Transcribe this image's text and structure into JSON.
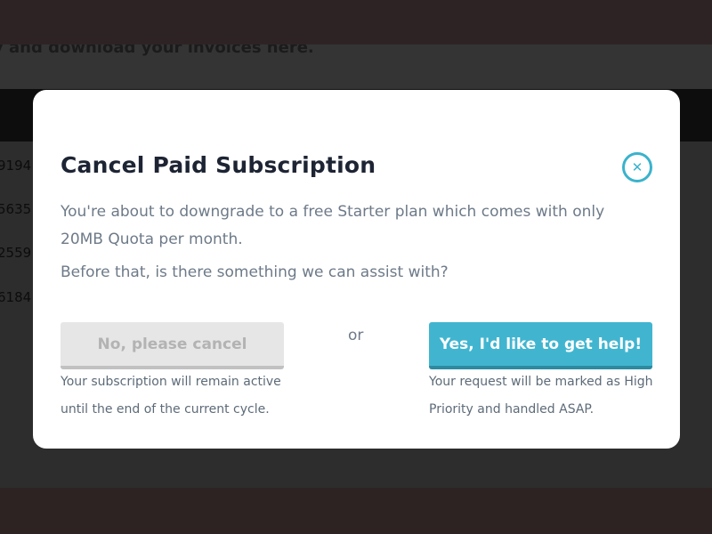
{
  "background": {
    "subtitle": "y and download your invoices here.",
    "row_numbers": [
      "9194",
      "5635",
      "2559",
      "6184"
    ]
  },
  "modal": {
    "title": "Cancel Paid Subscription",
    "close_icon": "close-icon",
    "description": "You're about to downgrade to a free Starter plan which comes with only 20MB Quota per month.",
    "question": "Before that, is there something we can assist with?",
    "cancel_button_label": "No, please cancel",
    "cancel_note": "Your subscription will remain active until the end of the current cycle.",
    "or_label": "or",
    "help_button_label": "Yes, I'd like to get help!",
    "help_note": "Your request will be marked as High Priority and handled ASAP."
  },
  "colors": {
    "accent": "#41b5d0",
    "title": "#1d2433",
    "body_text": "#6d7a88",
    "cancel_button": "#e6e6e6"
  }
}
